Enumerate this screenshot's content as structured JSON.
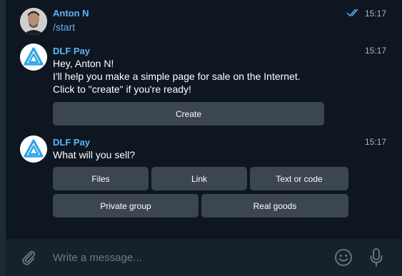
{
  "colors": {
    "background": "#0e1621",
    "sender": "#5eb5f7",
    "button": "#3b4651",
    "time": "#aab7c4"
  },
  "messages": [
    {
      "sender": "Anton N",
      "text": "/start",
      "time": "15:17",
      "status_icon": "double-check-icon"
    },
    {
      "sender": "DLF Pay",
      "lines": [
        "Hey, Anton N!",
        "I'll help you make a simple page for sale on the Internet.",
        "Click to \"create\" if you're ready!"
      ],
      "time": "15:17",
      "buttons": [
        "Create"
      ]
    },
    {
      "sender": "DLF Pay",
      "lines": [
        "What will you sell?"
      ],
      "time": "15:17",
      "buttons_row1": [
        "Files",
        "Link",
        "Text or code"
      ],
      "buttons_row2": [
        "Private group",
        "Real goods"
      ]
    }
  ],
  "composer": {
    "placeholder": "Write a message...",
    "icons": [
      "paperclip-icon",
      "smile-icon",
      "microphone-icon"
    ]
  }
}
